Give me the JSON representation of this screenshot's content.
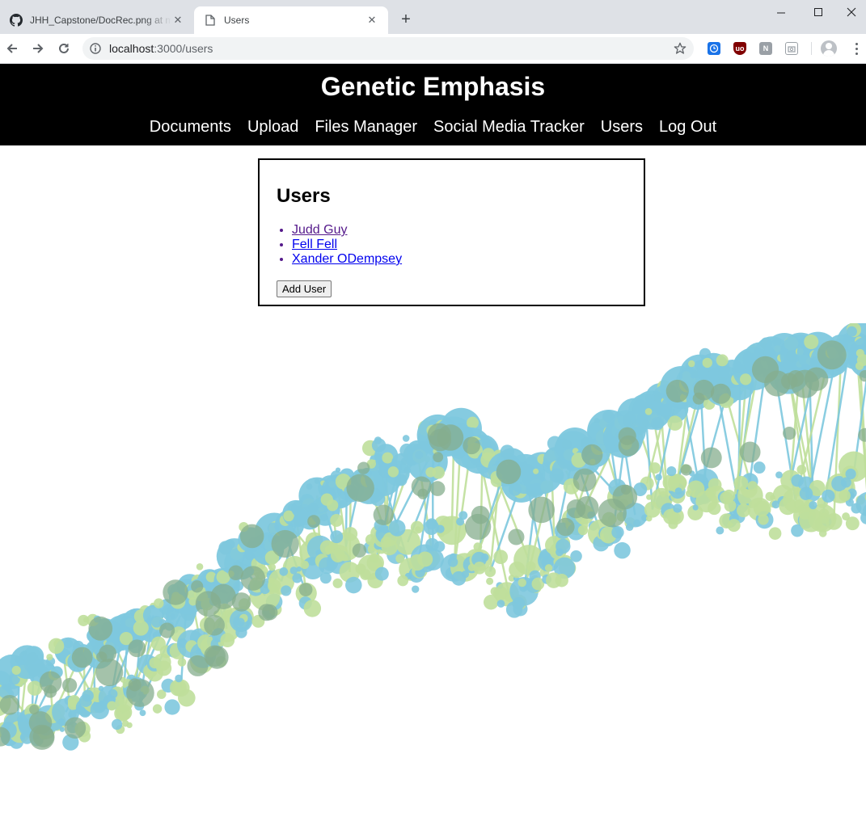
{
  "browser": {
    "tabs": [
      {
        "title": "JHH_Capstone/DocRec.png at master",
        "favicon": "github-icon",
        "active": false
      },
      {
        "title": "Users",
        "favicon": "document-icon",
        "active": true
      }
    ],
    "url_host": "localhost",
    "url_path": ":3000/users"
  },
  "site": {
    "title": "Genetic Emphasis",
    "nav": [
      "Documents",
      "Upload",
      "Files Manager",
      "Social Media Tracker",
      "Users",
      "Log Out"
    ]
  },
  "users_panel": {
    "heading": "Users",
    "users": [
      "Judd Guy",
      "Fell Fell",
      "Xander ODempsey"
    ],
    "add_button": "Add User"
  },
  "colors": {
    "header_bg": "#000000",
    "dna_blue": "#7ec8de",
    "dna_green": "#bfdf9b",
    "dna_overlap": "#86ae8e"
  }
}
